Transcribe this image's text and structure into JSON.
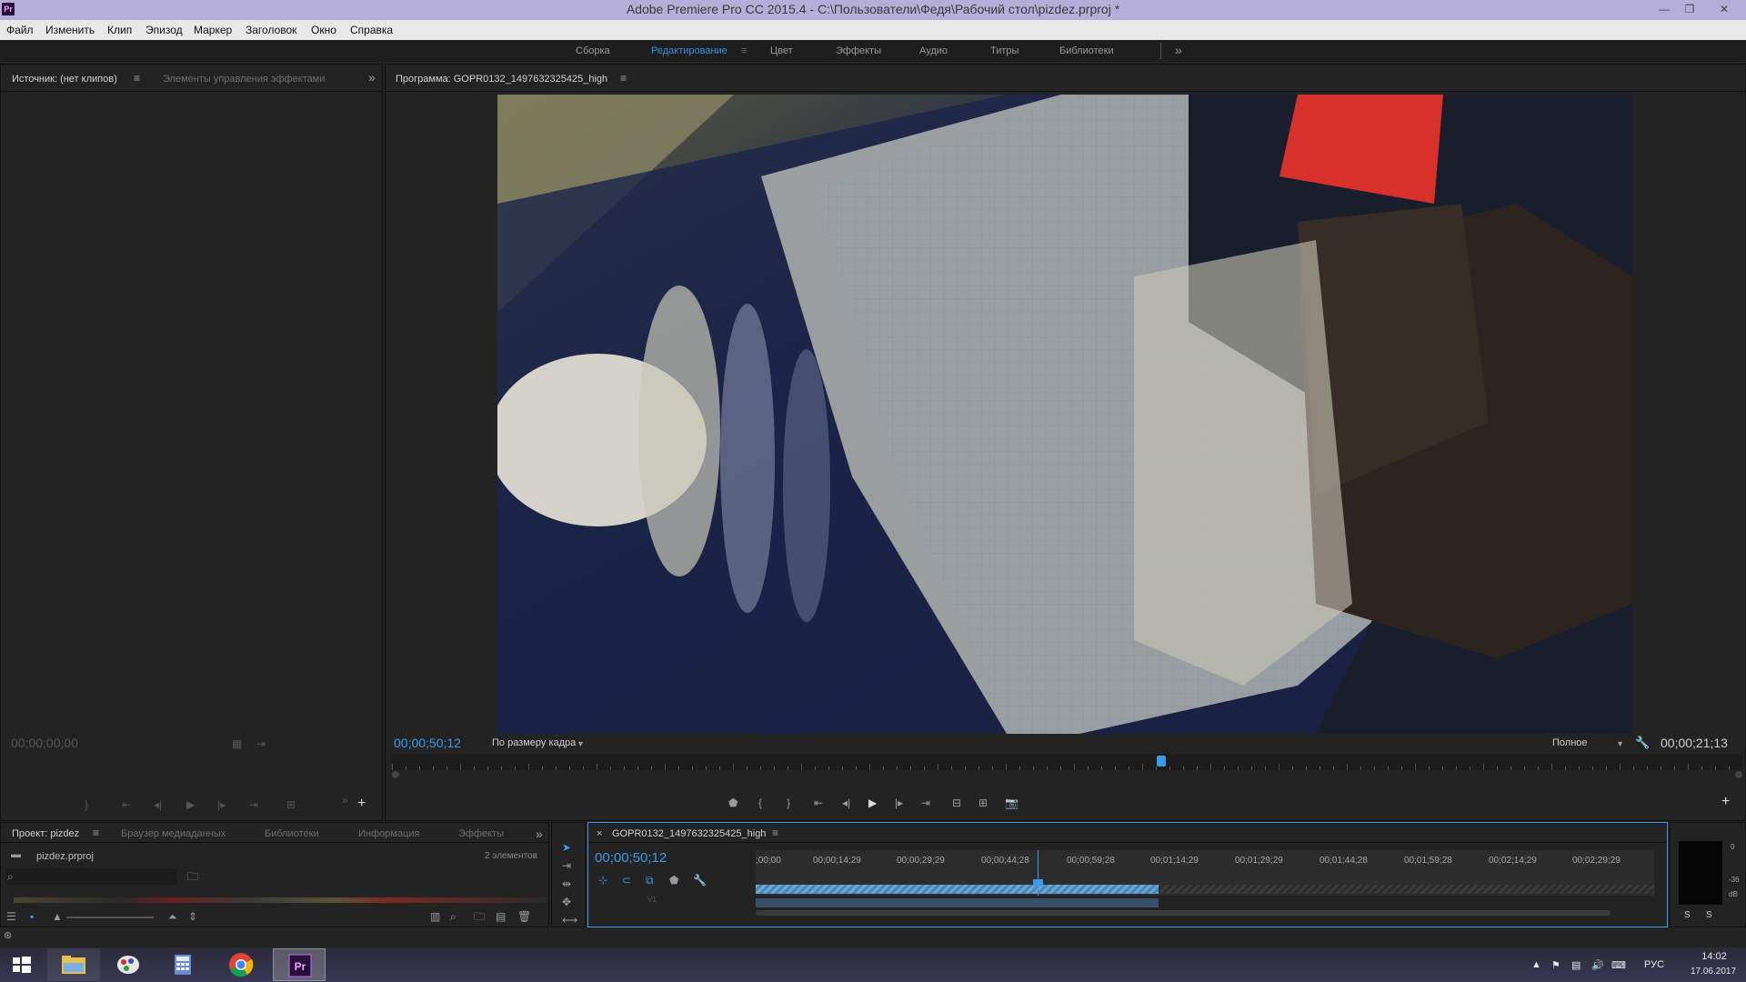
{
  "window": {
    "title": "Adobe Premiere Pro CC 2015.4 - C:\\Пользователи\\Федя\\Рабочий стол\\pizdez.prproj *",
    "logo": "Pr"
  },
  "menu": [
    "Файл",
    "Изменить",
    "Клип",
    "Эпизод",
    "Маркер",
    "Заголовок",
    "Окно",
    "Справка"
  ],
  "workspaces": {
    "items": [
      "Сборка",
      "Редактирование",
      "Цвет",
      "Эффекты",
      "Аудио",
      "Титры",
      "Библиотеки"
    ],
    "active": "Редактирование"
  },
  "source_panel": {
    "tab_source": "Источник: (нет клипов)",
    "tab_effect_controls": "Элементы управления эффектами",
    "timecode": "00;00;00;00"
  },
  "program_panel": {
    "tab": "Программа: GOPR0132_1497632325425_high",
    "timecode": "00;00;50;12",
    "fit": "По размеру кадра",
    "quality": "Полное",
    "duration": "00;00;21;13",
    "playhead_position_fraction": 0.57
  },
  "project_panel": {
    "tabs": [
      "Проект: pizdez",
      "Браузер медиаданных",
      "Библиотеки",
      "Информация",
      "Эффекты"
    ],
    "file": "pizdez.prproj",
    "count": "2 элементов"
  },
  "timeline": {
    "tab": "GOPR0132_1497632325425_high",
    "timecode": "00;00;50;12",
    "ticks": [
      ";00;00",
      "00;00;14;29",
      "00;00;29;29",
      "00;00;44;28",
      "00;00;59;28",
      "00;01;14;29",
      "00;01;29;29",
      "00;01;44;28",
      "00;01;59;28",
      "00;02;14;29",
      "00;02;29;29"
    ],
    "track_label": "V1"
  },
  "audio_meter": {
    "labels": [
      "0",
      "-36",
      "dB"
    ],
    "solo": [
      "S",
      "S"
    ]
  },
  "taskbar": {
    "apps": [
      "windows-start",
      "file-explorer",
      "paint",
      "calculator",
      "chrome",
      "premiere-pro"
    ],
    "lang": "РУС",
    "time": "14:02",
    "date": "17.06.2017"
  }
}
